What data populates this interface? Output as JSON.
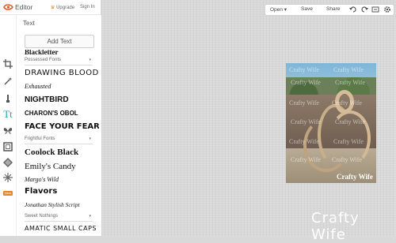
{
  "app": {
    "name": "Editor",
    "upgrade": "Upgrade",
    "signin": "Sign In"
  },
  "panel": {
    "title": "Text",
    "add_text": "Add Text",
    "categories": {
      "possessed": "Possessed Fonts",
      "frightful": "Frightful Fonts",
      "sweet": "Sweet Nothings"
    },
    "fonts": [
      "Blackletter",
      "DRAWING BLOOD",
      "Exhausted",
      "NIGHTBIRD",
      "CHARON'S OBOL",
      "FACE YOUR FEARS",
      "Coolock Black",
      "Emily's Candy",
      "Margo's Wild",
      "Flavors",
      "Jonathan Stylish Script",
      "AMATIC SMALL CAPS"
    ]
  },
  "toolbar": {
    "open": "Open",
    "save": "Save",
    "share": "Share"
  },
  "canvas": {
    "watermark": "Crafty Wife",
    "caption": "Crafty Wife"
  },
  "icons": [
    "logo-icon",
    "crop-icon",
    "wand-icon",
    "brush-icon",
    "text-icon",
    "butterfly-icon",
    "frame-icon",
    "texture-icon",
    "seasonal-icon",
    "undo-icon",
    "redo-icon",
    "history-icon",
    "gear-icon",
    "crown-icon"
  ],
  "colors": {
    "accent": "#2aa6a6",
    "premium": "#e3862f",
    "brand": "#e35b2a"
  }
}
